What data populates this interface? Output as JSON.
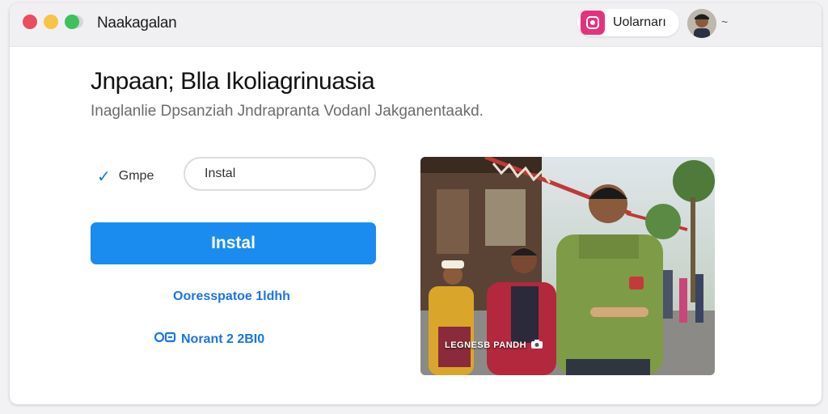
{
  "titlebar": {
    "app_title": "Naakagalan",
    "profile_name": "Uolarnarı"
  },
  "main": {
    "heading": "Jnpaan; Blla Ikoliagrinuasia",
    "subheading": "Inaglanlie Dpsanziah Jndrapranta Vodanl Jakganentaakd.",
    "check_label": "Gmpe",
    "search_value": "Instal",
    "primary_button": "Instal",
    "link_one": "Ooresspatoe 1ldhh",
    "link_two": "Norant 2 2BI0"
  },
  "photo": {
    "caption": "LEGNESB PANDH"
  },
  "colors": {
    "accent": "#1a8cf0",
    "link": "#1a73e8",
    "app_icon": "#e4327c"
  },
  "icons": [
    "close-dot",
    "minimize-dot",
    "maximize-dot",
    "app-icon",
    "checkmark-icon",
    "link-icon",
    "camera-icon"
  ]
}
